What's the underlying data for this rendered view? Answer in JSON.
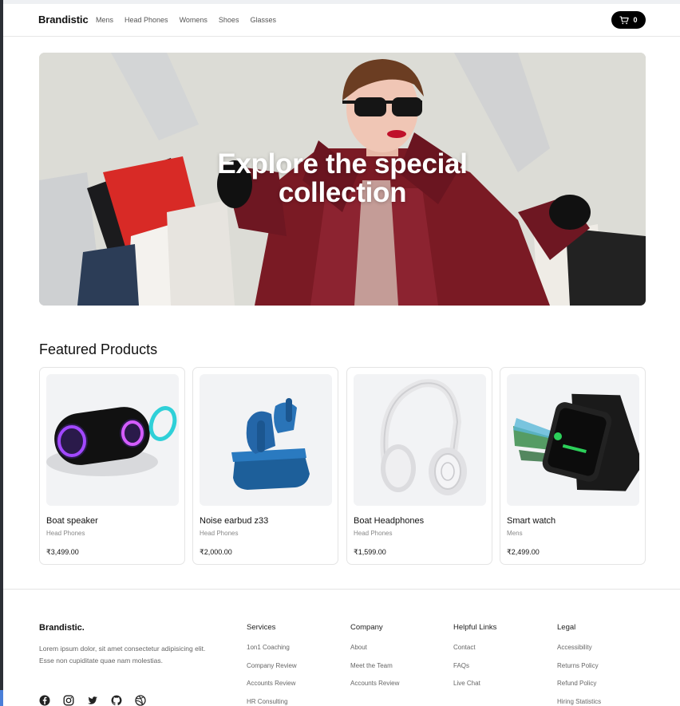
{
  "navbar": {
    "brand": "Brandistic",
    "links": [
      "Mens",
      "Head Phones",
      "Womens",
      "Shoes",
      "Glasses"
    ],
    "cart_count": "0"
  },
  "hero": {
    "title_line1": "Explore the special",
    "title_line2": "collection"
  },
  "featured": {
    "title": "Featured Products",
    "products": [
      {
        "name": "Boat speaker",
        "category": "Head Phones",
        "price": "₹3,499.00"
      },
      {
        "name": "Noise earbud z33",
        "category": "Head Phones",
        "price": "₹2,000.00"
      },
      {
        "name": "Boat Headphones",
        "category": "Head Phones",
        "price": "₹1,599.00"
      },
      {
        "name": "Smart watch",
        "category": "Mens",
        "price": "₹2,499.00"
      }
    ]
  },
  "footer": {
    "brand": "Brandistic.",
    "description": "Lorem ipsum dolor, sit amet consectetur adipisicing elit. Esse non cupiditate quae nam molestias.",
    "columns": [
      {
        "title": "Services",
        "links": [
          "1on1 Coaching",
          "Company Review",
          "Accounts Review",
          "HR Consulting"
        ]
      },
      {
        "title": "Company",
        "links": [
          "About",
          "Meet the Team",
          "Accounts Review"
        ]
      },
      {
        "title": "Helpful Links",
        "links": [
          "Contact",
          "FAQs",
          "Live Chat"
        ]
      },
      {
        "title": "Legal",
        "links": [
          "Accessibility",
          "Returns Policy",
          "Refund Policy",
          "Hiring Statistics"
        ]
      }
    ],
    "social_icons": [
      "facebook-icon",
      "instagram-icon",
      "twitter-icon",
      "github-icon",
      "dribbble-icon"
    ]
  },
  "colors": {
    "accent": "#000000",
    "hero_coat": "#7a1a24",
    "card_bg": "#f2f3f5"
  }
}
